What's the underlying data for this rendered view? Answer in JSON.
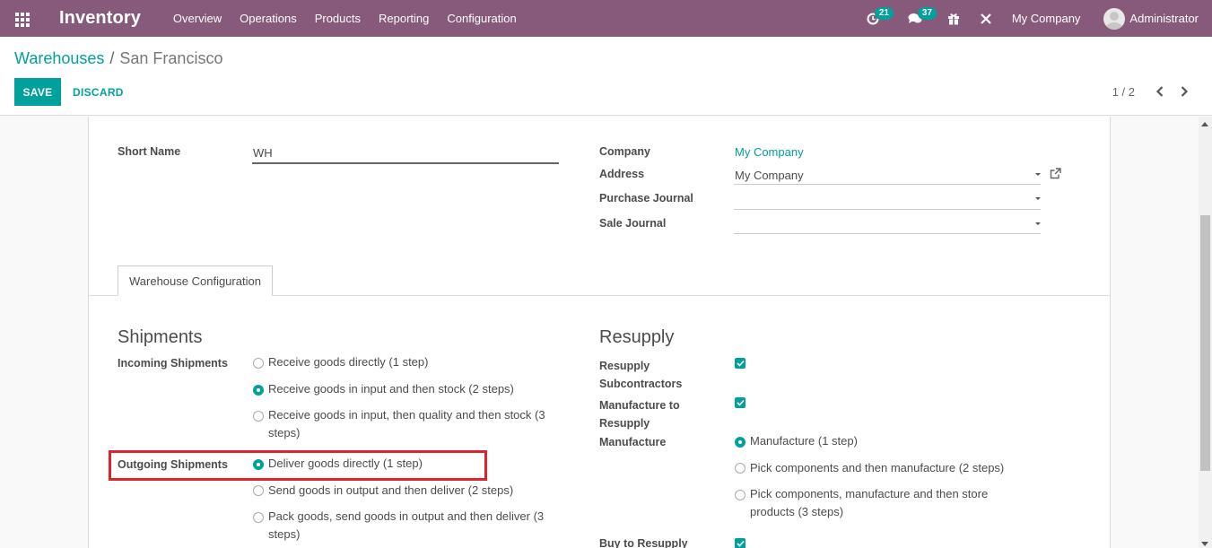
{
  "navbar": {
    "app_name": "Inventory",
    "menu": [
      "Overview",
      "Operations",
      "Products",
      "Reporting",
      "Configuration"
    ],
    "activity_count": "21",
    "messages_count": "37",
    "company": "My Company",
    "user": "Administrator"
  },
  "breadcrumb": {
    "parent": "Warehouses",
    "separator": "/",
    "current": "San Francisco"
  },
  "actions": {
    "save": "SAVE",
    "discard": "DISCARD"
  },
  "pager": {
    "value": "1 / 2"
  },
  "form": {
    "short_name_label": "Short Name",
    "short_name_value": "WH",
    "company_label": "Company",
    "company_value": "My Company",
    "address_label": "Address",
    "address_value": "My Company",
    "purchase_journal_label": "Purchase Journal",
    "purchase_journal_value": "",
    "sale_journal_label": "Sale Journal",
    "sale_journal_value": ""
  },
  "tabs": [
    "Warehouse Configuration"
  ],
  "shipments": {
    "title": "Shipments",
    "incoming_label": "Incoming Shipments",
    "incoming_options": [
      {
        "line1": "Receive goods directly (1 step)",
        "line2": "",
        "checked": false
      },
      {
        "line1": "Receive goods in input and then stock (2 steps)",
        "line2": "",
        "checked": true
      },
      {
        "line1": "Receive goods in input, then quality and then stock (3",
        "line2": "steps)",
        "checked": false
      }
    ],
    "outgoing_label": "Outgoing Shipments",
    "outgoing_options": [
      {
        "line1": "Deliver goods directly (1 step)",
        "line2": "",
        "checked": true
      },
      {
        "line1": "Send goods in output and then deliver (2 steps)",
        "line2": "",
        "checked": false
      },
      {
        "line1": "Pack goods, send goods in output and then deliver (3",
        "line2": "steps)",
        "checked": false
      }
    ]
  },
  "resupply": {
    "title": "Resupply",
    "resupply_subcontractors_line1": "Resupply",
    "resupply_subcontractors_line2": "Subcontractors",
    "resupply_subcontractors_checked": true,
    "manufacture_to_resupply_line1": "Manufacture to",
    "manufacture_to_resupply_line2": "Resupply",
    "manufacture_to_resupply_checked": true,
    "manufacture_label": "Manufacture",
    "manufacture_options": [
      {
        "line1": "Manufacture (1 step)",
        "line2": "",
        "checked": true
      },
      {
        "line1": "Pick components and then manufacture (2 steps)",
        "line2": "",
        "checked": false
      },
      {
        "line1": "Pick components, manufacture and then store",
        "line2": "products (3 steps)",
        "checked": false
      }
    ],
    "buy_to_resupply_label": "Buy to Resupply",
    "buy_to_resupply_checked": true
  },
  "colors": {
    "navbar": "#875a7b",
    "accent": "#00a09d",
    "highlight": "#e0222c"
  }
}
